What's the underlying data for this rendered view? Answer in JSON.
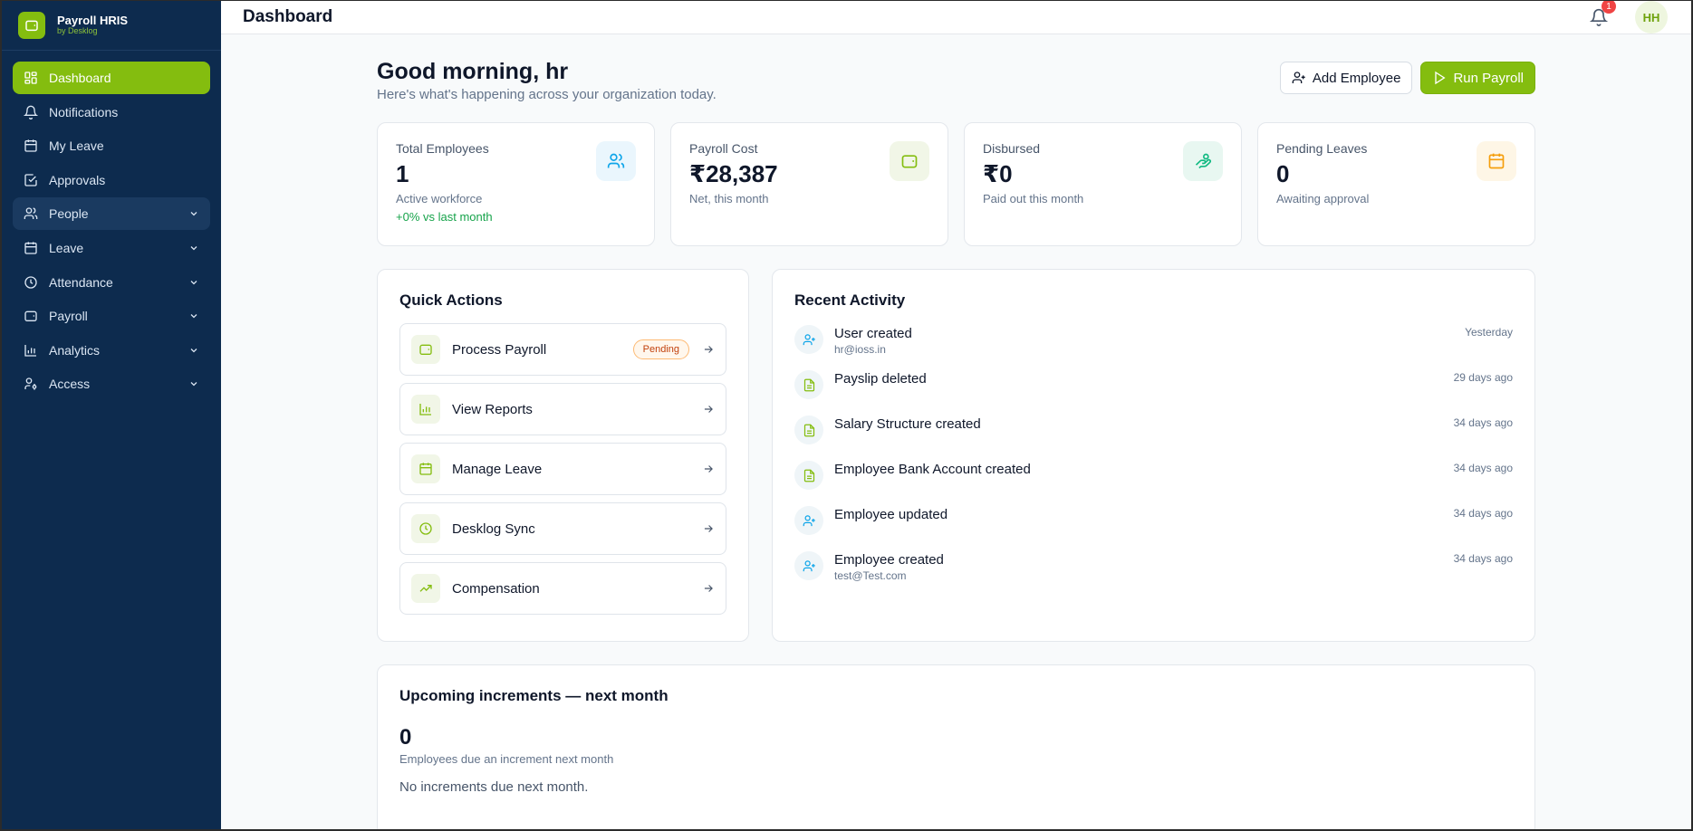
{
  "brand": {
    "title": "Payroll HRIS",
    "subtitle": "by Desklog"
  },
  "sidebar": {
    "items": [
      {
        "label": "Dashboard",
        "icon": "layout-grid-icon"
      },
      {
        "label": "Notifications",
        "icon": "bell-icon"
      },
      {
        "label": "My Leave",
        "icon": "calendar-icon"
      },
      {
        "label": "Approvals",
        "icon": "check-square-icon"
      },
      {
        "label": "People",
        "icon": "users-icon"
      },
      {
        "label": "Leave",
        "icon": "calendar-icon"
      },
      {
        "label": "Attendance",
        "icon": "clock-icon"
      },
      {
        "label": "Payroll",
        "icon": "wallet-icon"
      },
      {
        "label": "Analytics",
        "icon": "bar-chart-icon"
      },
      {
        "label": "Access",
        "icon": "user-key-icon"
      }
    ]
  },
  "topbar": {
    "title": "Dashboard",
    "notification_count": "1",
    "avatar_initials": "HH"
  },
  "greeting": {
    "title": "Good morning, hr",
    "subtitle": "Here's what's happening across your organization today."
  },
  "actions": {
    "add_employee": "Add Employee",
    "run_payroll": "Run Payroll"
  },
  "stats": [
    {
      "label": "Total Employees",
      "value": "1",
      "sub": "Active workforce",
      "trend": "+0% vs last month",
      "icon": "users-icon",
      "accent": "#0ea5e9"
    },
    {
      "label": "Payroll Cost",
      "value": "₹28,387",
      "sub": "Net, this month",
      "icon": "wallet-icon",
      "accent": "#84bd0f"
    },
    {
      "label": "Disbursed",
      "value": "₹0",
      "sub": "Paid out this month",
      "icon": "hand-coins-icon",
      "accent": "#10b981"
    },
    {
      "label": "Pending Leaves",
      "value": "0",
      "sub": "Awaiting approval",
      "icon": "calendar-icon",
      "accent": "#f59e0b"
    }
  ],
  "quick_actions": {
    "title": "Quick Actions",
    "items": [
      {
        "label": "Process Payroll",
        "badge": "Pending",
        "icon": "wallet-icon"
      },
      {
        "label": "View Reports",
        "icon": "bar-chart-icon"
      },
      {
        "label": "Manage Leave",
        "icon": "calendar-icon"
      },
      {
        "label": "Desklog Sync",
        "icon": "clock-icon"
      },
      {
        "label": "Compensation",
        "icon": "trending-up-icon"
      }
    ]
  },
  "recent_activity": {
    "title": "Recent Activity",
    "items": [
      {
        "title": "User created",
        "sub": "hr@ioss.in",
        "time": "Yesterday",
        "icon": "user-plus-icon"
      },
      {
        "title": "Payslip deleted",
        "time": "29 days ago",
        "icon": "file-text-icon"
      },
      {
        "title": "Salary Structure created",
        "time": "34 days ago",
        "icon": "file-text-icon"
      },
      {
        "title": "Employee Bank Account created",
        "time": "34 days ago",
        "icon": "file-text-icon"
      },
      {
        "title": "Employee updated",
        "time": "34 days ago",
        "icon": "user-plus-icon"
      },
      {
        "title": "Employee created",
        "sub": "test@Test.com",
        "time": "34 days ago",
        "icon": "user-plus-icon"
      }
    ]
  },
  "increments": {
    "title": "Upcoming increments — next month",
    "value": "0",
    "sub": "Employees due an increment next month",
    "empty": "No increments due next month."
  }
}
